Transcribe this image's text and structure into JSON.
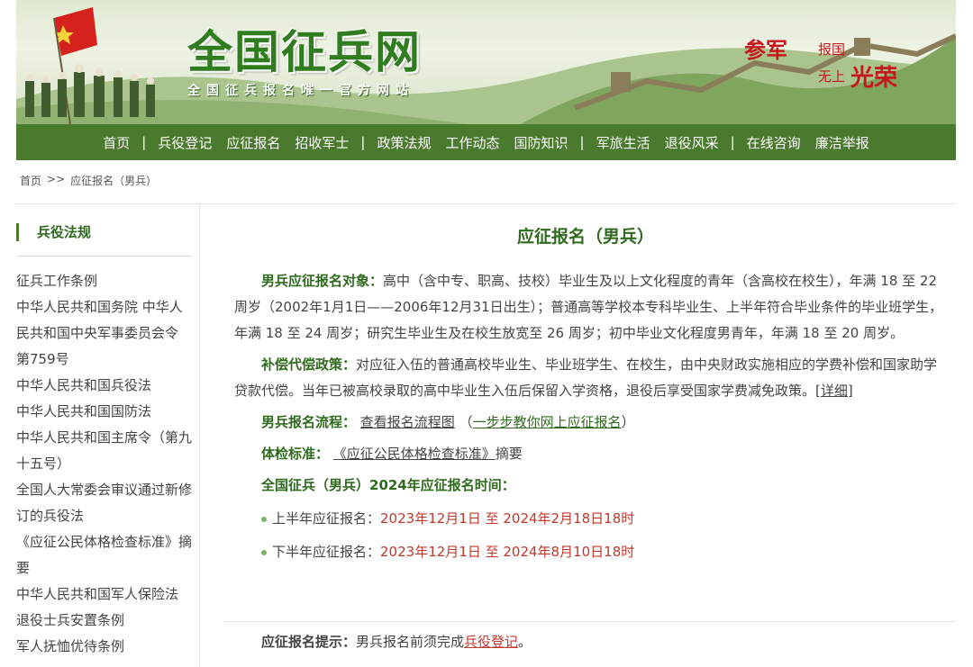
{
  "banner": {
    "logo": "全国征兵网",
    "slogan": "全国征兵报名唯一官方网站",
    "motto": [
      "参军",
      "报国",
      "无上",
      "光荣"
    ],
    "colors": {
      "brand_green": "#4a7a2d",
      "accent_red": "#c8161d"
    }
  },
  "nav": {
    "items": [
      "首页",
      "兵役登记",
      "应征报名",
      "招收军士",
      "政策法规",
      "工作动态",
      "国防知识",
      "军旅生活",
      "退役风采",
      "在线咨询",
      "廉洁举报"
    ],
    "separator": "|"
  },
  "breadcrumb": {
    "home": "首页",
    "sep": ">>",
    "current": "应征报名（男兵）"
  },
  "sidebar": {
    "title": "兵役法规",
    "items": [
      "征兵工作条例",
      "中华人民共和国务院 中华人民共和国中央军事委员会令 第759号",
      "中华人民共和国兵役法",
      "中华人民共和国国防法",
      "中华人民共和国主席令（第九十五号）",
      "全国人大常委会审议通过新修订的兵役法",
      "《应征公民体格检查标准》摘要",
      "中华人民共和国军人保险法",
      "退役士兵安置条例",
      "军人抚恤优待条例"
    ]
  },
  "main": {
    "title": "应征报名（男兵）",
    "target_label": "男兵应征报名对象：",
    "target_text": "高中（含中专、职高、技校）毕业生及以上文化程度的青年（含高校在校生），年满 18 至 22 周岁（2002年1月1日——2006年12月31日出生）；普通高等学校本专科毕业生、上半年符合毕业条件的毕业班学生，年满 18 至 24 周岁；研究生毕业生及在校生放宽至 26 周岁；初中毕业文化程度男青年，年满 18 至 20 周岁。",
    "policy_label": "补偿代偿政策：",
    "policy_text": "对应征入伍的普通高校毕业生、毕业班学生、在校生，由中央财政实施相应的学费补偿和国家助学贷款代偿。当年已被高校录取的高中毕业生入伍后保留入学资格，退役后享受国家学费减免政策。",
    "policy_link": "[详细]",
    "process_label": "男兵报名流程：",
    "process_link": "查看报名流程图",
    "process_paren_open": "（",
    "process_link2": "一步步教你网上应征报名",
    "process_paren_close": "）",
    "exam_label": "体检标准：",
    "exam_link": "《应征公民体格检查标准》",
    "exam_suffix": "摘要",
    "time_title": "全国征兵（男兵）2024年应征报名时间：",
    "first_half_label": "上半年应征报名：",
    "first_half_value": "2023年12月1日 至 2024年2月18日18时",
    "second_half_label": "下半年应征报名：",
    "second_half_value": "2023年12月1日 至 2024年8月10日18时"
  },
  "tip": {
    "label": "应征报名提示：",
    "text": "男兵报名前须完成",
    "link": "兵役登记",
    "end": "。"
  }
}
